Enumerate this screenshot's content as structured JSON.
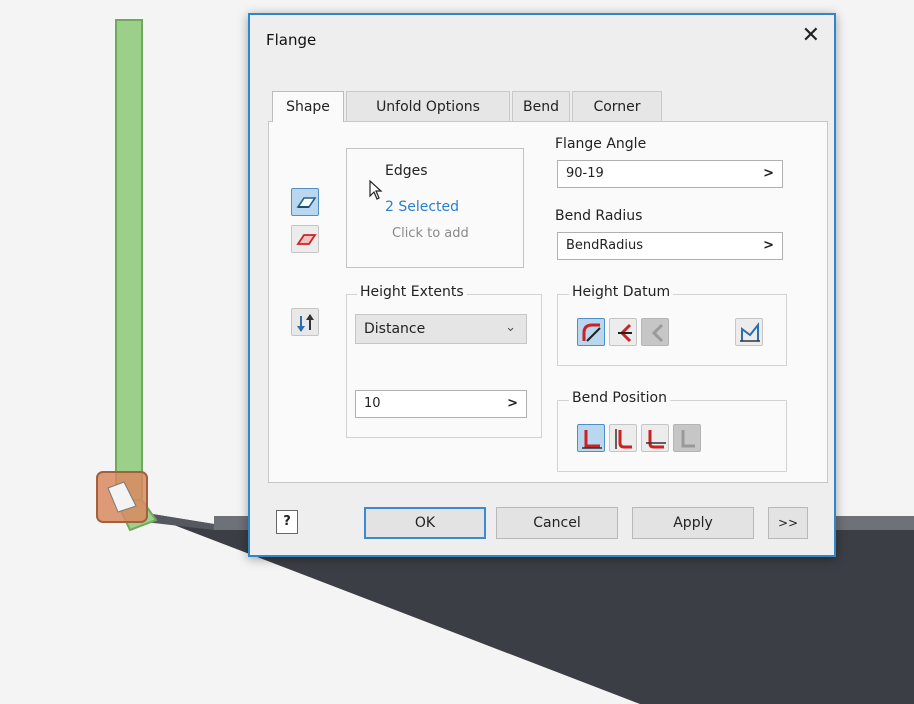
{
  "dialog": {
    "title": "Flange",
    "close_glyph": "✕",
    "tabs": [
      {
        "label": "Shape",
        "active": true
      },
      {
        "label": "Unfold Options",
        "active": false
      },
      {
        "label": "Bend",
        "active": false
      },
      {
        "label": "Corner",
        "active": false
      }
    ],
    "edges": {
      "title": "Edges",
      "selected": "2 Selected",
      "hint": "Click to add",
      "mode_icons": [
        "edge-select-icon",
        "loop-select-icon"
      ]
    },
    "flange_angle": {
      "label": "Flange Angle",
      "value": "90-19",
      "chevron": ">"
    },
    "bend_radius": {
      "label": "Bend Radius",
      "value": "BendRadius",
      "chevron": ">"
    },
    "height_extents": {
      "label": "Height Extents",
      "type": "Distance",
      "type_chevron": "⌄",
      "distance": "10",
      "chevron": ">",
      "flip_icon": "flip-direction-icon"
    },
    "height_datum": {
      "label": "Height Datum",
      "options": [
        {
          "icon": "outer-face-datum-icon",
          "state": "selected"
        },
        {
          "icon": "inner-face-datum-icon",
          "state": "normal"
        },
        {
          "icon": "tangent-datum-icon",
          "state": "disabled"
        },
        {
          "icon": "aligned-datum-icon",
          "state": "normal"
        }
      ]
    },
    "bend_position": {
      "label": "Bend Position",
      "options": [
        {
          "icon": "inside-base-face-icon",
          "state": "selected"
        },
        {
          "icon": "bend-from-face-icon",
          "state": "normal"
        },
        {
          "icon": "outside-base-face-icon",
          "state": "normal"
        },
        {
          "icon": "tangent-to-face-icon",
          "state": "disabled"
        }
      ]
    },
    "footer": {
      "help": "?",
      "ok": "OK",
      "cancel": "Cancel",
      "apply": "Apply",
      "more": ">>"
    }
  },
  "colors": {
    "accent": "#2f86c8",
    "selected_bg": "#b9d7ef",
    "link": "#2a7fca",
    "flange_preview": "#9ccf8a",
    "part_dark": "#3b3e44",
    "gizmo": "#d98a5f"
  }
}
